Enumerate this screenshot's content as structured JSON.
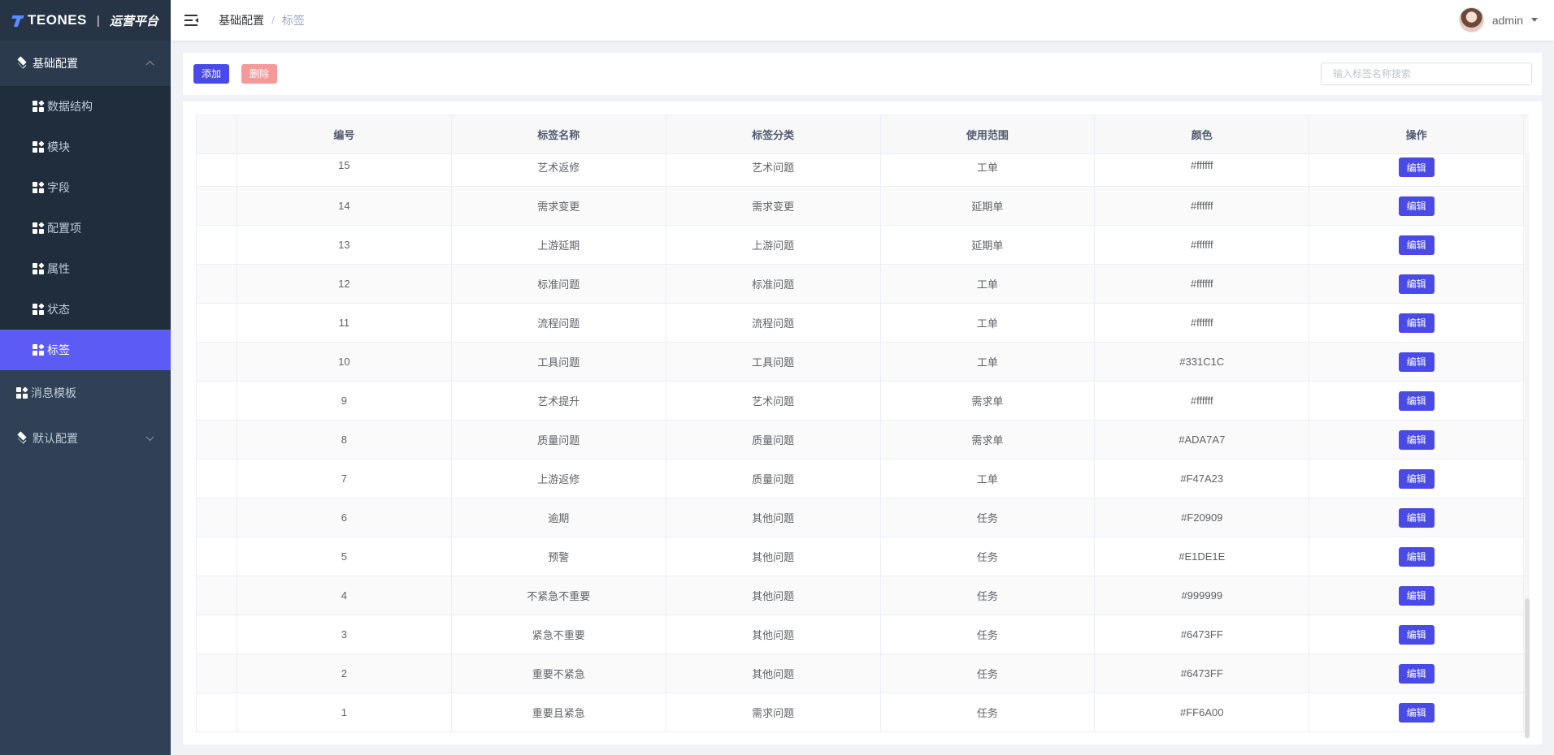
{
  "logo": {
    "brand": "TEONES",
    "separator": "|",
    "subtitle": "运营平台"
  },
  "sidebar": {
    "group_basic": "基础配置",
    "sub_items": [
      "数据结构",
      "模块",
      "字段",
      "配置项",
      "属性",
      "状态",
      "标签"
    ],
    "active_item": "标签",
    "message_template": "消息模板",
    "group_default": "默认配置"
  },
  "header": {
    "breadcrumb": [
      "基础配置",
      "标签"
    ],
    "breadcrumb_separator": "/",
    "username": "admin"
  },
  "toolbar": {
    "add_label": "添加",
    "delete_label": "删除",
    "search_placeholder": "输入标签名称搜索",
    "search_value": ""
  },
  "table": {
    "columns": [
      "编号",
      "标签名称",
      "标签分类",
      "使用范围",
      "颜色",
      "操作"
    ],
    "edit_label": "编辑",
    "rows": [
      {
        "id": "15",
        "name": "艺术返修",
        "category": "艺术问题",
        "scope": "工单",
        "color": "#ffffff"
      },
      {
        "id": "14",
        "name": "需求变更",
        "category": "需求变更",
        "scope": "延期单",
        "color": "#ffffff"
      },
      {
        "id": "13",
        "name": "上游延期",
        "category": "上游问题",
        "scope": "延期单",
        "color": "#ffffff"
      },
      {
        "id": "12",
        "name": "标准问题",
        "category": "标准问题",
        "scope": "工单",
        "color": "#ffffff"
      },
      {
        "id": "11",
        "name": "流程问题",
        "category": "流程问题",
        "scope": "工单",
        "color": "#ffffff"
      },
      {
        "id": "10",
        "name": "工具问题",
        "category": "工具问题",
        "scope": "工单",
        "color": "#331C1C"
      },
      {
        "id": "9",
        "name": "艺术提升",
        "category": "艺术问题",
        "scope": "需求单",
        "color": "#ffffff"
      },
      {
        "id": "8",
        "name": "质量问题",
        "category": "质量问题",
        "scope": "需求单",
        "color": "#ADA7A7"
      },
      {
        "id": "7",
        "name": "上游返修",
        "category": "质量问题",
        "scope": "工单",
        "color": "#F47A23"
      },
      {
        "id": "6",
        "name": "逾期",
        "category": "其他问题",
        "scope": "任务",
        "color": "#F20909"
      },
      {
        "id": "5",
        "name": "预警",
        "category": "其他问题",
        "scope": "任务",
        "color": "#E1DE1E"
      },
      {
        "id": "4",
        "name": "不紧急不重要",
        "category": "其他问题",
        "scope": "任务",
        "color": "#999999"
      },
      {
        "id": "3",
        "name": "紧急不重要",
        "category": "其他问题",
        "scope": "任务",
        "color": "#6473FF"
      },
      {
        "id": "2",
        "name": "重要不紧急",
        "category": "其他问题",
        "scope": "任务",
        "color": "#6473FF"
      },
      {
        "id": "1",
        "name": "重要且紧急",
        "category": "需求问题",
        "scope": "任务",
        "color": "#FF6A00"
      }
    ]
  }
}
